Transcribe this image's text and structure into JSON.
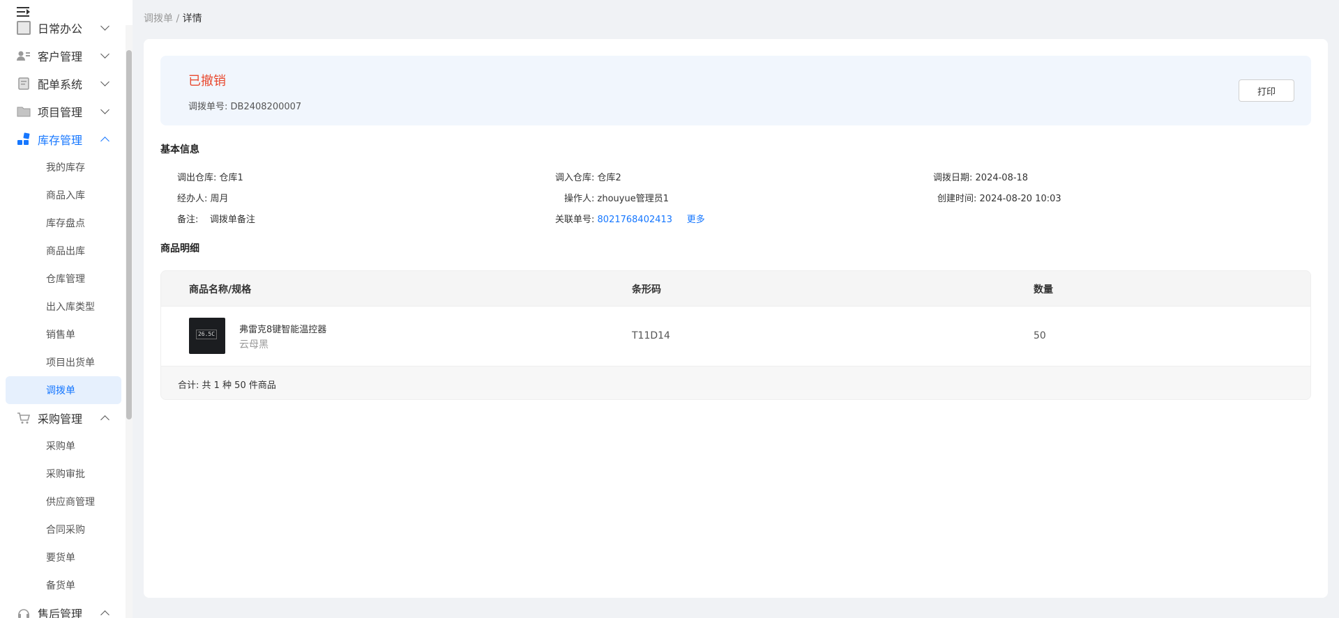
{
  "sidebar": {
    "groups": [
      {
        "label": "日常办公",
        "icon": "document-icon",
        "expanded": false
      },
      {
        "label": "客户管理",
        "icon": "customer-card-icon",
        "expanded": false
      },
      {
        "label": "配单系统",
        "icon": "document-icon",
        "expanded": false
      },
      {
        "label": "项目管理",
        "icon": "folder-icon",
        "expanded": false
      },
      {
        "label": "库存管理",
        "icon": "inventory-blocks-icon",
        "expanded": true,
        "active": true
      },
      {
        "label": "采购管理",
        "icon": "cart-icon",
        "expanded": true
      },
      {
        "label": "售后管理",
        "icon": "headset-icon",
        "expanded": true
      }
    ],
    "inventory_items": [
      "我的库存",
      "商品入库",
      "库存盘点",
      "商品出库",
      "仓库管理",
      "出入库类型",
      "销售单",
      "项目出货单",
      "调拨单"
    ],
    "purchase_items": [
      "采购单",
      "采购审批",
      "供应商管理",
      "合同采购",
      "要货单",
      "备货单"
    ],
    "selected_item": "调拨单"
  },
  "breadcrumb": {
    "parent": "调拨单",
    "separator": " / ",
    "current": "详情"
  },
  "status": {
    "title": "已撤销",
    "order_no_label": "调拨单号:",
    "order_no": "DB2408200007",
    "print_label": "打印"
  },
  "basic_info": {
    "title": "基本信息",
    "out_warehouse_label": "调出仓库:",
    "out_warehouse": "仓库1",
    "in_warehouse_label": "调入仓库:",
    "in_warehouse": "仓库2",
    "date_label": "调拨日期:",
    "date": "2024-08-18",
    "handler_label": "经办人:",
    "handler": "周月",
    "operator_label": "操作人:",
    "operator": "zhouyue管理员1",
    "created_label": "创建时间:",
    "created": "2024-08-20 10:03",
    "remark_label": "备注:",
    "remark": "调拨单备注",
    "related_label": "关联单号:",
    "related_no": "8021768402413",
    "more_label": "更多"
  },
  "products": {
    "title": "商品明细",
    "columns": [
      "商品名称/规格",
      "条形码",
      "数量"
    ],
    "rows": [
      {
        "name": "弗雷克8键智能温控器",
        "spec": "云母黑",
        "barcode": "T11D14",
        "quantity": "50",
        "thumb_text": "26.5C"
      }
    ],
    "summary": "合计: 共 1 种 50 件商品"
  },
  "colors": {
    "accent": "#1677ff",
    "status_revoked": "#e8492f",
    "status_panel_bg": "#f1f6fd"
  }
}
